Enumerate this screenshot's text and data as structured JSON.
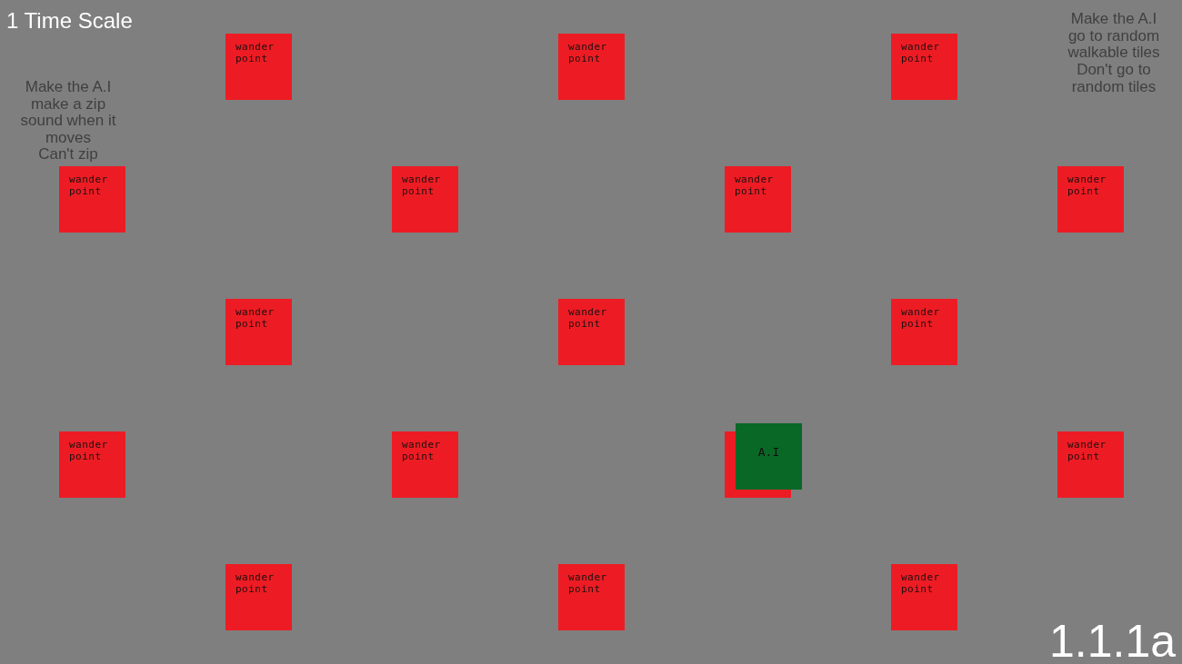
{
  "hud": {
    "time_scale": "1 Time Scale",
    "version": "1.1.1a"
  },
  "left_note": {
    "texts": [
      "Make the A.I make a zip sound when it moves",
      "Can't zip"
    ]
  },
  "right_note": {
    "texts": [
      "Make the A.I go to random walkable tiles",
      "Don't go to random tiles"
    ]
  },
  "grid": {
    "rows": [
      [
        {
          "kind": "wander_point",
          "label": "wander point"
        },
        {
          "kind": "wander_point",
          "label": "wander point"
        },
        {
          "kind": "wander_point",
          "label": "wander point"
        }
      ],
      [
        {
          "kind": "wander_point",
          "label": "wander point"
        },
        {
          "kind": "wander_point",
          "label": "wander point"
        },
        {
          "kind": "wander_point",
          "label": "wander point"
        },
        {
          "kind": "wander_point",
          "label": "wander point"
        }
      ],
      [
        {
          "kind": "wander_point",
          "label": "wander point"
        },
        {
          "kind": "wander_point",
          "label": "wander point"
        },
        {
          "kind": "wander_point",
          "label": "wander point"
        }
      ],
      [
        {
          "kind": "wander_point",
          "label": "wander point"
        },
        {
          "kind": "wander_point",
          "label": "wander point"
        },
        {
          "kind": "occupied",
          "agent_label": "A.I"
        },
        {
          "kind": "wander_point",
          "label": "wander point"
        }
      ],
      [
        {
          "kind": "wander_point",
          "label": "wander point"
        },
        {
          "kind": "wander_point",
          "label": "wander point"
        },
        {
          "kind": "wander_point",
          "label": "wander point"
        }
      ]
    ]
  }
}
